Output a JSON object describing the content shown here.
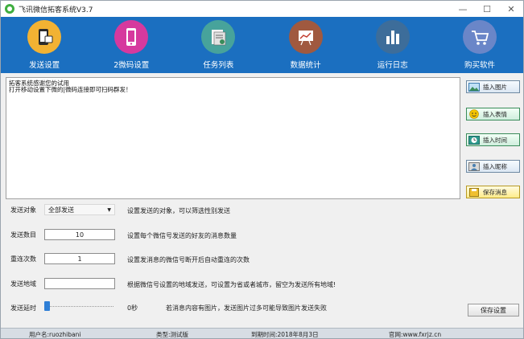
{
  "window": {
    "title": "飞讯微信拓客系统V3.7",
    "minimize": "—",
    "maximize": "☐",
    "close": "✕"
  },
  "toolbar": {
    "items": [
      {
        "label": "发送设置",
        "icon": "phone-send-icon",
        "color": "#f2b233"
      },
      {
        "label": "2微码设置",
        "icon": "phone-icon",
        "color": "#d6399e"
      },
      {
        "label": "任务列表",
        "icon": "task-list-icon",
        "color": "#47a39b"
      },
      {
        "label": "数据统计",
        "icon": "chart-board-icon",
        "color": "#a0593f"
      },
      {
        "label": "运行日志",
        "icon": "bar-chart-icon",
        "color": "#3d6d9a"
      },
      {
        "label": "购买软件",
        "icon": "cart-icon",
        "color": "#6a86c8"
      }
    ]
  },
  "editor": {
    "line1": "拓客系统感谢您的试用",
    "line2": "打开移动设置下微的|微码连接即可扫码群发！"
  },
  "side_buttons": [
    {
      "label": "插入图片",
      "icon": "image-icon"
    },
    {
      "label": "插入表情",
      "icon": "smiley-icon"
    },
    {
      "label": "插入时间",
      "icon": "clock-icon"
    },
    {
      "label": "插入昵称",
      "icon": "person-icon"
    },
    {
      "label": "保存消息",
      "icon": "save-icon"
    }
  ],
  "settings": {
    "target": {
      "label": "发送对象",
      "value": "全部发送",
      "desc": "设置发送的对象，可以筛选性别发送"
    },
    "count": {
      "label": "发送数目",
      "value": "10",
      "desc": "设置每个微信号发送的好友的消息数量"
    },
    "reconnect": {
      "label": "重连次数",
      "value": "1",
      "desc": "设置发消息的微信号断开后自动重连的次数"
    },
    "region": {
      "label": "发送地域",
      "value": "",
      "desc": "根据微信号设置的地域发送，可设置为省或者城市，留空为发送所有地域!"
    },
    "interval": {
      "label": "发送延时",
      "value": "0秒",
      "desc": "若消息内容有图片，发送图片过多可能导致图片发送失败",
      "level": 0
    },
    "save_label": "保存设置"
  },
  "status": {
    "user": "用户名:ruozhibani",
    "type": "类型:测试版",
    "expiry": "到期时间:2018年8月3日",
    "site": "官网:www.fxrjz.cn"
  }
}
